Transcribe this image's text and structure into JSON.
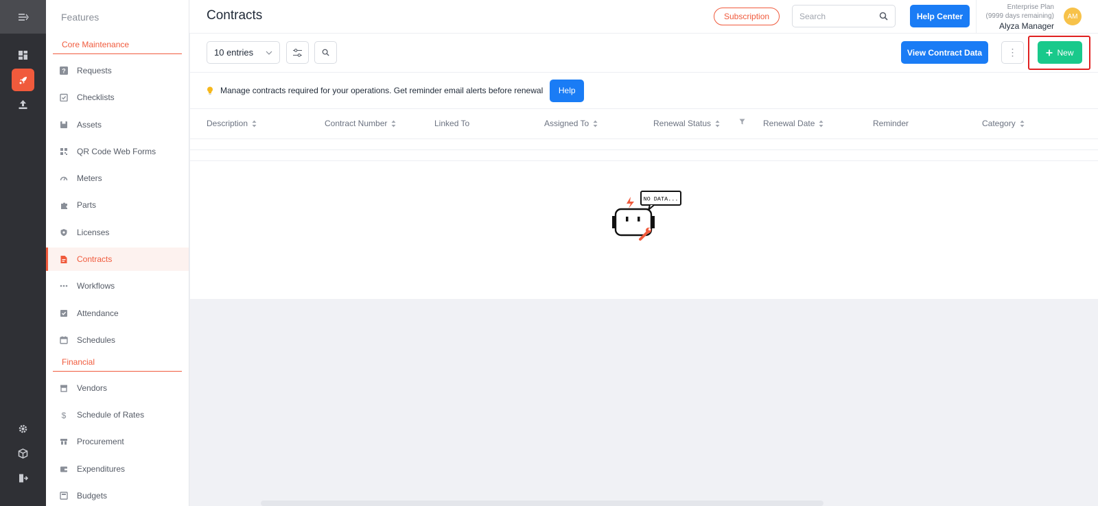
{
  "features_title": "Features",
  "header": {
    "title": "Contracts",
    "subscription_label": "Subscription",
    "search_placeholder": "Search",
    "help_center_label": "Help Center",
    "plan_name": "Enterprise Plan",
    "plan_remaining": "(9999 days remaining)",
    "user_name": "Alyza Manager",
    "avatar_initials": "AM"
  },
  "sections": {
    "core": "Core Maintenance",
    "financial": "Financial"
  },
  "nav": {
    "core_items": [
      {
        "label": "Requests",
        "icon": "question-icon"
      },
      {
        "label": "Checklists",
        "icon": "checklist-icon"
      },
      {
        "label": "Assets",
        "icon": "asset-icon"
      },
      {
        "label": "QR Code Web Forms",
        "icon": "qr-icon"
      },
      {
        "label": "Meters",
        "icon": "gauge-icon"
      },
      {
        "label": "Parts",
        "icon": "puzzle-icon"
      },
      {
        "label": "Licenses",
        "icon": "shield-icon"
      },
      {
        "label": "Contracts",
        "icon": "contract-icon"
      },
      {
        "label": "Workflows",
        "icon": "dots-icon"
      },
      {
        "label": "Attendance",
        "icon": "attendance-icon"
      },
      {
        "label": "Schedules",
        "icon": "calendar-icon"
      }
    ],
    "financial_items": [
      {
        "label": "Vendors",
        "icon": "store-icon"
      },
      {
        "label": "Schedule of Rates",
        "icon": "dollar-icon"
      },
      {
        "label": "Procurement",
        "icon": "procurement-icon"
      },
      {
        "label": "Expenditures",
        "icon": "wallet-icon"
      },
      {
        "label": "Budgets",
        "icon": "budget-icon"
      }
    ]
  },
  "toolbar": {
    "entries_label": "10 entries",
    "view_contract_label": "View Contract Data",
    "more_label": "⋮",
    "new_label": "New"
  },
  "info": {
    "text": "Manage contracts required for your operations. Get reminder email alerts before renewal",
    "help_label": "Help"
  },
  "table": {
    "columns": [
      "Description",
      "Contract Number",
      "Linked To",
      "Assigned To",
      "Renewal Status",
      "Renewal Date",
      "Reminder",
      "Category"
    ]
  },
  "empty_state": {
    "bubble_text": "NO DATA..."
  }
}
